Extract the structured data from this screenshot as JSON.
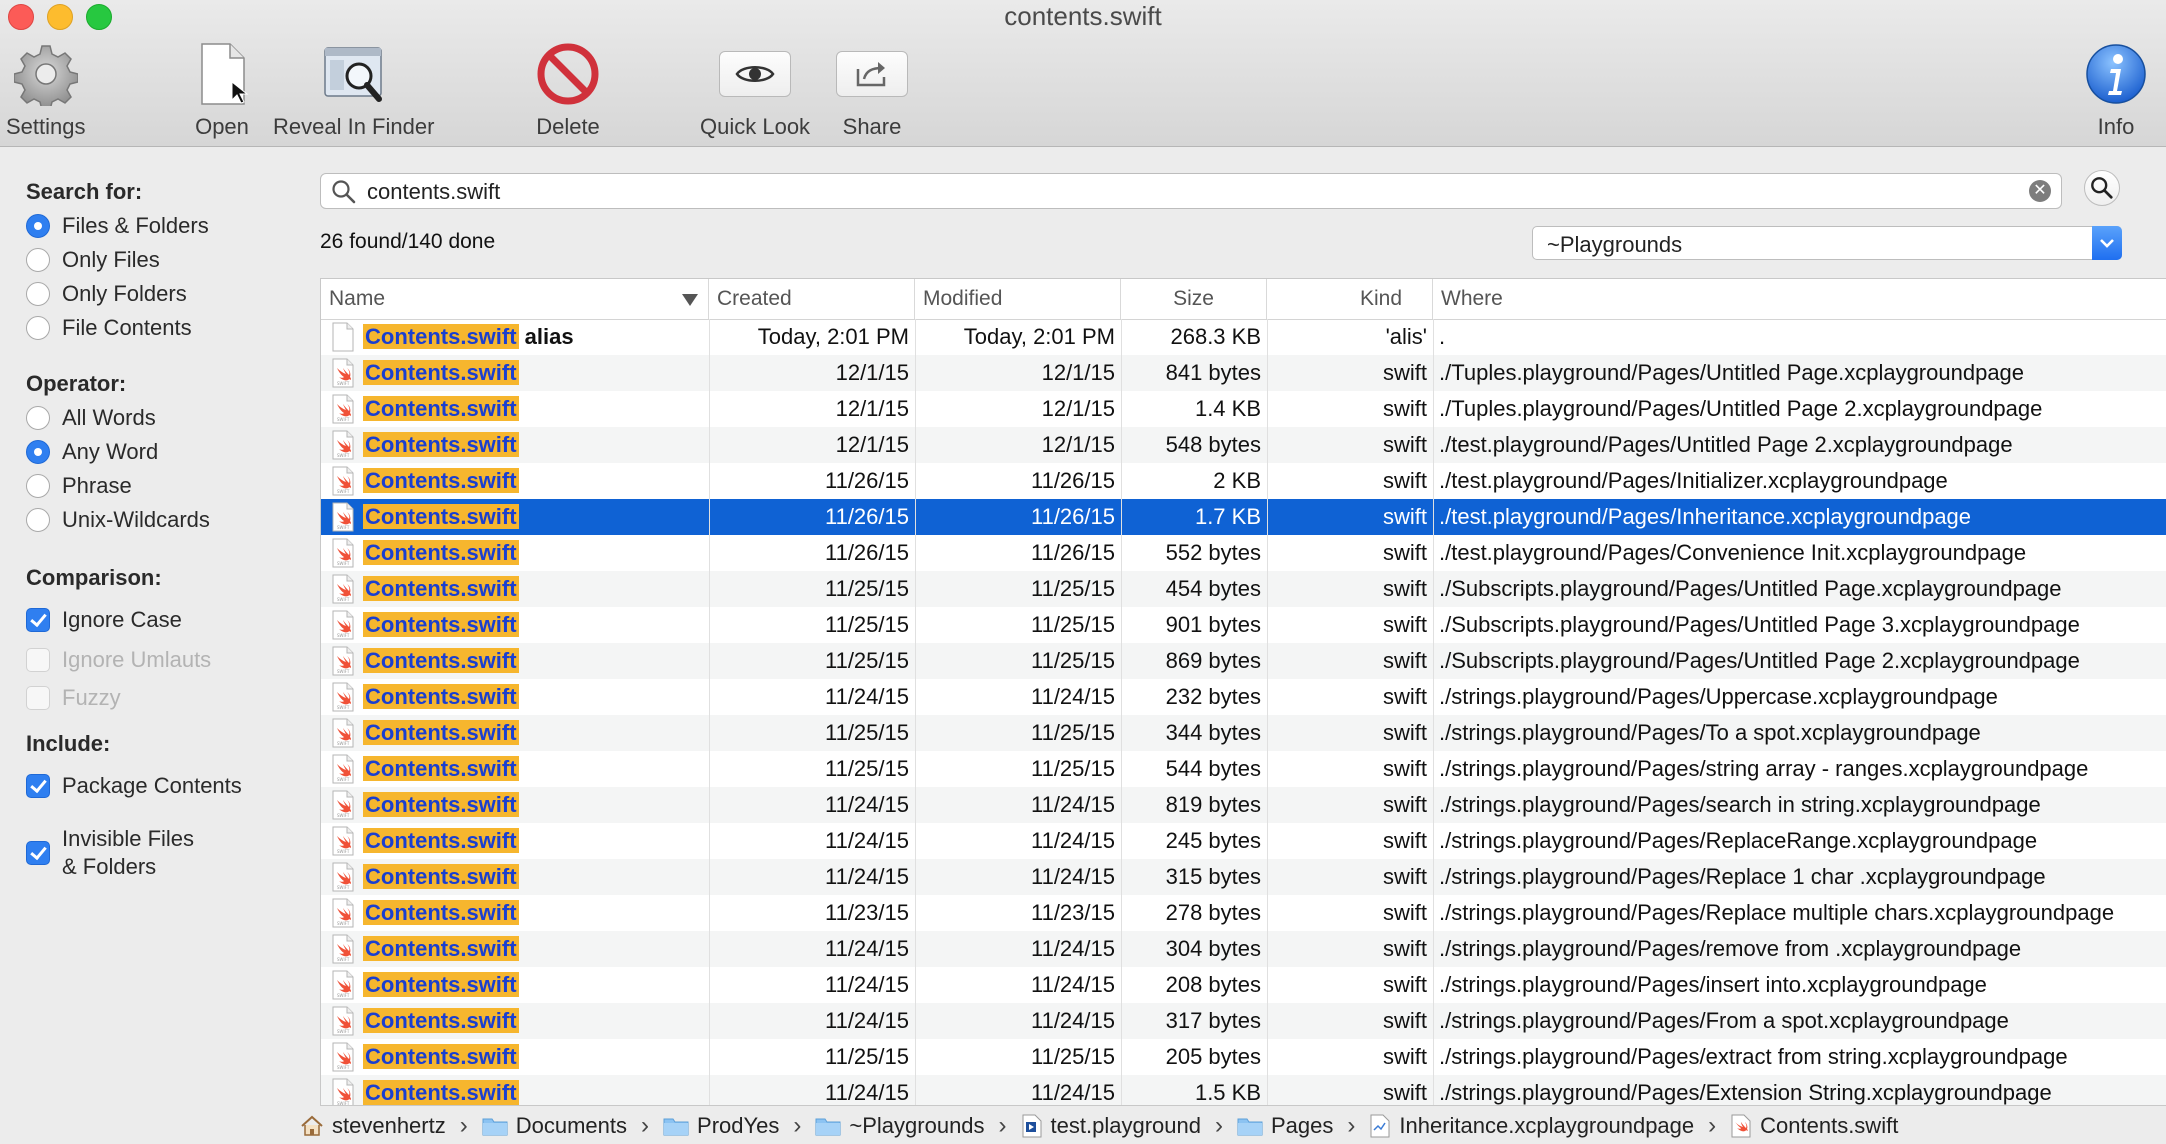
{
  "window": {
    "title": "contents.swift"
  },
  "toolbar": {
    "settings": "Settings",
    "open": "Open",
    "reveal": "Reveal In Finder",
    "delete": "Delete",
    "quick_look": "Quick Look",
    "share": "Share",
    "info": "Info"
  },
  "sidebar": {
    "search_for_title": "Search for:",
    "search_for": [
      "Files & Folders",
      "Only Files",
      "Only Folders",
      "File Contents"
    ],
    "search_for_selected": "Files & Folders",
    "operator_title": "Operator:",
    "operator": [
      "All Words",
      "Any Word",
      "Phrase",
      "Unix-Wildcards"
    ],
    "operator_selected": "Any Word",
    "comparison_title": "Comparison:",
    "ignore_case": "Ignore Case",
    "ignore_umlauts": "Ignore Umlauts",
    "fuzzy": "Fuzzy",
    "include_title": "Include:",
    "package_contents": "Package Contents",
    "invisible_line1": "Invisible Files",
    "invisible_line2": "& Folders"
  },
  "search": {
    "query": "contents.swift",
    "status": "26 found/140 done",
    "scope": "~Playgrounds"
  },
  "table": {
    "columns": {
      "name": "Name",
      "created": "Created",
      "modified": "Modified",
      "size": "Size",
      "kind": "Kind",
      "where": "Where"
    },
    "rows": [
      {
        "name": "Contents.swift",
        "suffix": "alias",
        "created": "Today, 2:01 PM",
        "modified": "Today, 2:01 PM",
        "size": "268.3 KB",
        "kind": "'alis'",
        "where": "."
      },
      {
        "name": "Contents.swift",
        "suffix": "",
        "created": "12/1/15",
        "modified": "12/1/15",
        "size": "841 bytes",
        "kind": "swift",
        "where": "./Tuples.playground/Pages/Untitled Page.xcplaygroundpage"
      },
      {
        "name": "Contents.swift",
        "suffix": "",
        "created": "12/1/15",
        "modified": "12/1/15",
        "size": "1.4 KB",
        "kind": "swift",
        "where": "./Tuples.playground/Pages/Untitled Page 2.xcplaygroundpage"
      },
      {
        "name": "Contents.swift",
        "suffix": "",
        "created": "12/1/15",
        "modified": "12/1/15",
        "size": "548 bytes",
        "kind": "swift",
        "where": "./test.playground/Pages/Untitled Page 2.xcplaygroundpage"
      },
      {
        "name": "Contents.swift",
        "suffix": "",
        "created": "11/26/15",
        "modified": "11/26/15",
        "size": "2 KB",
        "kind": "swift",
        "where": "./test.playground/Pages/Initializer.xcplaygroundpage"
      },
      {
        "name": "Contents.swift",
        "suffix": "",
        "created": "11/26/15",
        "modified": "11/26/15",
        "size": "1.7 KB",
        "kind": "swift",
        "where": "./test.playground/Pages/Inheritance.xcplaygroundpage"
      },
      {
        "name": "Contents.swift",
        "suffix": "",
        "created": "11/26/15",
        "modified": "11/26/15",
        "size": "552 bytes",
        "kind": "swift",
        "where": "./test.playground/Pages/Convenience Init.xcplaygroundpage"
      },
      {
        "name": "Contents.swift",
        "suffix": "",
        "created": "11/25/15",
        "modified": "11/25/15",
        "size": "454 bytes",
        "kind": "swift",
        "where": "./Subscripts.playground/Pages/Untitled Page.xcplaygroundpage"
      },
      {
        "name": "Contents.swift",
        "suffix": "",
        "created": "11/25/15",
        "modified": "11/25/15",
        "size": "901 bytes",
        "kind": "swift",
        "where": "./Subscripts.playground/Pages/Untitled Page 3.xcplaygroundpage"
      },
      {
        "name": "Contents.swift",
        "suffix": "",
        "created": "11/25/15",
        "modified": "11/25/15",
        "size": "869 bytes",
        "kind": "swift",
        "where": "./Subscripts.playground/Pages/Untitled Page 2.xcplaygroundpage"
      },
      {
        "name": "Contents.swift",
        "suffix": "",
        "created": "11/24/15",
        "modified": "11/24/15",
        "size": "232 bytes",
        "kind": "swift",
        "where": "./strings.playground/Pages/Uppercase.xcplaygroundpage"
      },
      {
        "name": "Contents.swift",
        "suffix": "",
        "created": "11/25/15",
        "modified": "11/25/15",
        "size": "344 bytes",
        "kind": "swift",
        "where": "./strings.playground/Pages/To a spot.xcplaygroundpage"
      },
      {
        "name": "Contents.swift",
        "suffix": "",
        "created": "11/25/15",
        "modified": "11/25/15",
        "size": "544 bytes",
        "kind": "swift",
        "where": "./strings.playground/Pages/string array - ranges.xcplaygroundpage"
      },
      {
        "name": "Contents.swift",
        "suffix": "",
        "created": "11/24/15",
        "modified": "11/24/15",
        "size": "819 bytes",
        "kind": "swift",
        "where": "./strings.playground/Pages/search in string.xcplaygroundpage"
      },
      {
        "name": "Contents.swift",
        "suffix": "",
        "created": "11/24/15",
        "modified": "11/24/15",
        "size": "245 bytes",
        "kind": "swift",
        "where": "./strings.playground/Pages/ReplaceRange.xcplaygroundpage"
      },
      {
        "name": "Contents.swift",
        "suffix": "",
        "created": "11/24/15",
        "modified": "11/24/15",
        "size": "315 bytes",
        "kind": "swift",
        "where": "./strings.playground/Pages/Replace 1 char .xcplaygroundpage"
      },
      {
        "name": "Contents.swift",
        "suffix": "",
        "created": "11/23/15",
        "modified": "11/23/15",
        "size": "278 bytes",
        "kind": "swift",
        "where": "./strings.playground/Pages/Replace  multiple chars.xcplaygroundpage"
      },
      {
        "name": "Contents.swift",
        "suffix": "",
        "created": "11/24/15",
        "modified": "11/24/15",
        "size": "304 bytes",
        "kind": "swift",
        "where": "./strings.playground/Pages/remove from .xcplaygroundpage"
      },
      {
        "name": "Contents.swift",
        "suffix": "",
        "created": "11/24/15",
        "modified": "11/24/15",
        "size": "208 bytes",
        "kind": "swift",
        "where": "./strings.playground/Pages/insert into.xcplaygroundpage"
      },
      {
        "name": "Contents.swift",
        "suffix": "",
        "created": "11/24/15",
        "modified": "11/24/15",
        "size": "317 bytes",
        "kind": "swift",
        "where": "./strings.playground/Pages/From a spot.xcplaygroundpage"
      },
      {
        "name": "Contents.swift",
        "suffix": "",
        "created": "11/25/15",
        "modified": "11/25/15",
        "size": "205 bytes",
        "kind": "swift",
        "where": "./strings.playground/Pages/extract from string.xcplaygroundpage"
      },
      {
        "name": "Contents.swift",
        "suffix": "",
        "created": "11/24/15",
        "modified": "11/24/15",
        "size": "1.5 KB",
        "kind": "swift",
        "where": "./strings.playground/Pages/Extension String.xcplaygroundpage"
      }
    ],
    "selected_row": 5
  },
  "pathbar": [
    "stevenhertz",
    "Documents",
    "ProdYes",
    "~Playgrounds",
    "test.playground",
    "Pages",
    "Inheritance.xcplaygroundpage",
    "Contents.swift"
  ],
  "colors": {
    "accent": "#2f7ff0",
    "selection": "#0f62d4",
    "highlight": "#f6b62e",
    "link_text": "#1a3fd0",
    "delete_red": "#d0313b"
  },
  "icons": {
    "settings": "gear-icon",
    "open": "document-icon",
    "reveal": "finder-magnifier-icon",
    "delete": "no-entry-icon",
    "quick_look": "eye-icon",
    "share": "share-arrow-icon",
    "info": "info-icon"
  }
}
